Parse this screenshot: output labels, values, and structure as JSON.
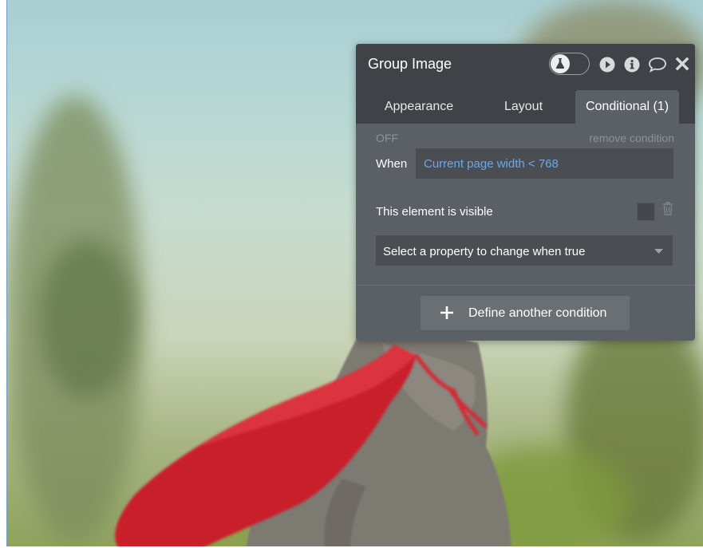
{
  "panel": {
    "title": "Group Image",
    "header_icons": [
      "flask-icon",
      "play-icon",
      "info-icon",
      "comment-icon",
      "close-icon"
    ]
  },
  "tabs": [
    {
      "label": "Appearance",
      "active": false
    },
    {
      "label": "Layout",
      "active": false
    },
    {
      "label": "Conditional (1)",
      "active": true
    }
  ],
  "condition": {
    "state": "OFF",
    "remove_label": "remove condition",
    "when_label": "When",
    "expression": "Current page width < 768",
    "visible_label": "This element is visible",
    "visible_checked": false,
    "property_placeholder": "Select a property to change when true"
  },
  "define_button": "Define another condition",
  "colors": {
    "panel_bg": "#5b6066",
    "header_bg": "#3f4347",
    "expression_text": "#6aa7ec"
  }
}
